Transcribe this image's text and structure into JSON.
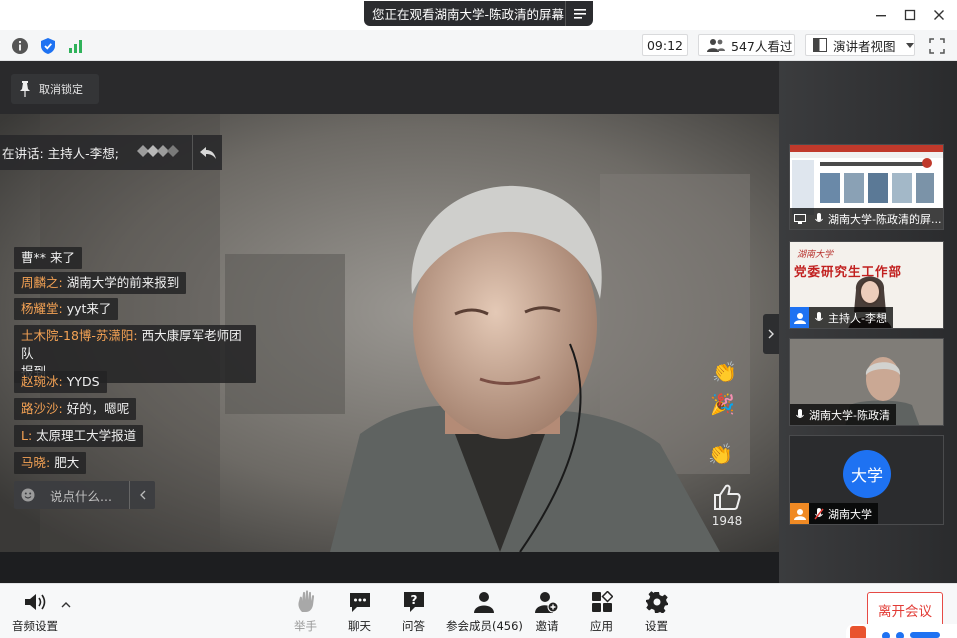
{
  "titlebar": {
    "viewing_banner": "您正在观看湖南大学-陈政清的屏幕"
  },
  "infobar": {
    "elapsed_time": "09:12",
    "viewers": "547人看过",
    "view_mode": "演讲者视图"
  },
  "stage": {
    "unpin_label": "取消锁定",
    "speaking_label": "在讲话: 主持人-李想;",
    "like_count": "1948"
  },
  "chat": {
    "messages": [
      {
        "name": "",
        "text": "曹** 来了"
      },
      {
        "name": "周麟之:",
        "text": " 湖南大学的前来报到"
      },
      {
        "name": "杨耀堂:",
        "text": " yyt来了"
      },
      {
        "name": "土木院-18博-苏潇阳:",
        "text": " 西大康厚军老师团队",
        "text2": "报到"
      },
      {
        "name": "赵琬冰:",
        "text": " YYDS"
      },
      {
        "name": "路沙沙:",
        "text": " 好的，嗯呢"
      },
      {
        "name": "L:",
        "text": " 太原理工大学报道"
      },
      {
        "name": "马晓:",
        "text": " 肥大"
      }
    ],
    "input_placeholder": "说点什么..."
  },
  "gallery": {
    "tiles": [
      {
        "label": "湖南大学-陈政清的屏..."
      },
      {
        "label": "主持人-李想",
        "banner": "党委研究生工作部",
        "school": "湖南大学"
      },
      {
        "label": "湖南大学-陈政清"
      },
      {
        "label": "湖南大学",
        "avatar_text": "大学"
      }
    ]
  },
  "toolbar": {
    "audio": "音频设置",
    "raise_hand": "举手",
    "chat": "聊天",
    "qa": "问答",
    "members": "参会成员(456)",
    "invite": "邀请",
    "apps": "应用",
    "settings": "设置",
    "leave": "离开会议"
  },
  "colors": {
    "accent_blue": "#1e72f2",
    "leave_red": "#e23b35",
    "chat_name_orange": "#f4a254",
    "signal_green": "#2fb25a"
  }
}
